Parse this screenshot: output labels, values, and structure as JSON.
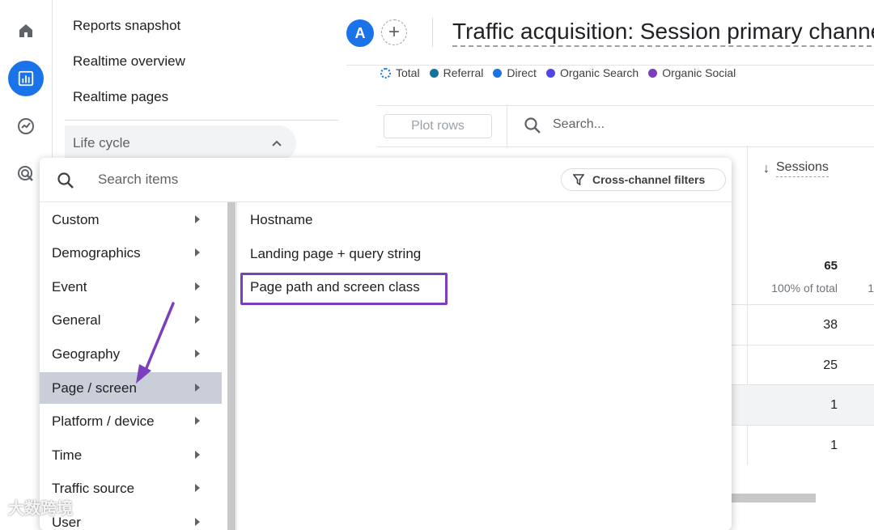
{
  "rail": {
    "icons": [
      "home-icon",
      "reports-icon",
      "explore-icon",
      "advertising-icon"
    ],
    "accent": "#1a73e8"
  },
  "nav": {
    "items": [
      {
        "label": "Reports snapshot"
      },
      {
        "label": "Realtime overview"
      },
      {
        "label": "Realtime pages"
      }
    ],
    "section_label": "Life cycle"
  },
  "header": {
    "avatar_letter": "A",
    "add_symbol": "+",
    "title": "Traffic acquisition: Session primary channel"
  },
  "legend": {
    "items": [
      {
        "label": "Total",
        "color": "#ffffff"
      },
      {
        "label": "Referral",
        "color": "#12739e"
      },
      {
        "label": "Direct",
        "color": "#1a73e8"
      },
      {
        "label": "Organic Search",
        "color": "#4f46e5"
      },
      {
        "label": "Organic Social",
        "color": "#7b3fbe"
      }
    ]
  },
  "table": {
    "plot_rows_label": "Plot rows",
    "search_placeholder": "Search...",
    "sessions_header": "Sessions",
    "sessions_arrow": "↓",
    "total_value": "65",
    "total_pct": "100% of total",
    "truncated_right": "1",
    "rows": [
      "38",
      "25",
      "1",
      "1"
    ]
  },
  "dropdown": {
    "search_placeholder": "Search items",
    "cross_channel_label": "Cross-channel filters",
    "categories": [
      {
        "label": "Custom"
      },
      {
        "label": "Demographics"
      },
      {
        "label": "Event"
      },
      {
        "label": "General"
      },
      {
        "label": "Geography"
      },
      {
        "label": "Page / screen"
      },
      {
        "label": "Platform / device"
      },
      {
        "label": "Time"
      },
      {
        "label": "Traffic source"
      },
      {
        "label": "User"
      }
    ],
    "selected_category": "Page / screen",
    "subitems": [
      {
        "label": "Hostname"
      },
      {
        "label": "Landing page + query string"
      },
      {
        "label": "Page path and screen class"
      }
    ],
    "highlighted_subitem": "Page path and screen class",
    "annotation_color": "#7b3fbe"
  },
  "watermark": "大数跨境"
}
